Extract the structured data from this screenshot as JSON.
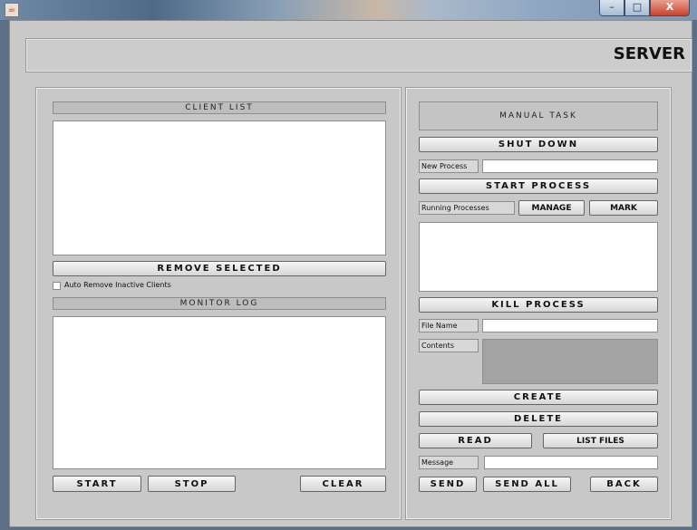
{
  "window": {
    "icon": "java-icon",
    "controls": {
      "minimize": "–",
      "maximize": "□",
      "close": "X"
    }
  },
  "header": {
    "title": "SERVER"
  },
  "left": {
    "client_list_title": "CLIENT LIST",
    "client_list_items": [],
    "remove_selected_label": "REMOVE SELECTED",
    "auto_remove_label": "Auto Remove Inactive Clients",
    "auto_remove_checked": false,
    "monitor_log_title": "MONITOR LOG",
    "monitor_log_text": "",
    "start_label": "START",
    "stop_label": "STOP",
    "clear_label": "CLEAR"
  },
  "right": {
    "manual_task_title": "MANUAL TASK",
    "shut_down_label": "SHUT DOWN",
    "new_process_label": "New Process",
    "new_process_value": "",
    "start_process_label": "START PROCESS",
    "running_processes_label": "Running Processes",
    "manage_label": "MANAGE",
    "mark_label": "MARK",
    "running_processes_items": [],
    "kill_process_label": "KILL PROCESS",
    "file_name_label": "File Name",
    "file_name_value": "",
    "contents_label": "Contents",
    "contents_value": "",
    "create_label": "CREATE",
    "delete_label": "DELETE",
    "read_label": "READ",
    "list_files_label": "LIST FILES",
    "message_label": "Message",
    "message_value": "",
    "send_label": "SEND",
    "send_all_label": "SEND ALL",
    "back_label": "BACK"
  }
}
